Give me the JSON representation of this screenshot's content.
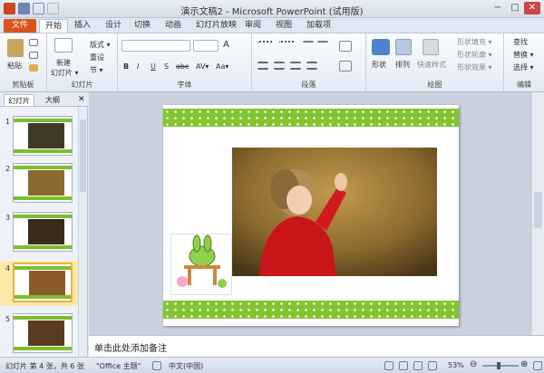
{
  "window": {
    "title": "演示文稿2 - Microsoft PowerPoint (试用版)"
  },
  "tabs": [
    {
      "label": "文件"
    },
    {
      "label": "开始"
    },
    {
      "label": "插入"
    },
    {
      "label": "设计"
    },
    {
      "label": "切换"
    },
    {
      "label": "动画"
    },
    {
      "label": "幻灯片放映"
    },
    {
      "label": "审阅"
    },
    {
      "label": "视图"
    },
    {
      "label": "加载项"
    }
  ],
  "ribbon": {
    "clipboard": {
      "paste": "粘贴",
      "group": "剪贴板"
    },
    "slides": {
      "new_slide": "新建",
      "new_slide2": "幻灯片 ▾",
      "layout": "版式 ▾",
      "reset": "重设",
      "section": "节 ▾",
      "group": "幻灯片"
    },
    "font": {
      "group": "字体",
      "bold": "B",
      "italic": "I",
      "underline": "U",
      "strike": "S",
      "abc": "abc",
      "av": "AV▾",
      "aa": "Aa▾",
      "a": "A"
    },
    "paragraph": {
      "group": "段落"
    },
    "drawing": {
      "shapes": "形状",
      "arrange": "排列",
      "quick_styles": "快速样式",
      "fill": "形状填充 ▾",
      "outline": "形状轮廓 ▾",
      "effects": "形状效果 ▾",
      "group": "绘图"
    },
    "editing": {
      "find": "查找",
      "replace": "替换 ▾",
      "select": "选择 ▾",
      "group": "编辑"
    }
  },
  "left_pane": {
    "tab_slides": "幻灯片",
    "tab_outline": "大纲",
    "close": "✕",
    "slides": [
      {
        "number": "1"
      },
      {
        "number": "2"
      },
      {
        "number": "3"
      },
      {
        "number": "4",
        "selected": true
      },
      {
        "number": "5"
      }
    ]
  },
  "notes": {
    "placeholder": "单击此处添加备注"
  },
  "status": {
    "slide_info": "幻灯片 第 4 张，共 6 张",
    "theme": "\"Office 主题\"",
    "language": "中文(中国)",
    "zoom": "53%"
  },
  "colors": {
    "file_tab": "#d8531f",
    "slide_band": "#84c431",
    "selected_thumb": "#e8b245"
  }
}
